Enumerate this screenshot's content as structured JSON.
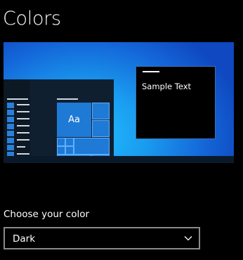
{
  "page": {
    "title": "Colors"
  },
  "preview": {
    "sample_text": "Sample Text",
    "tile_label": "Aa",
    "accent_color": "#1f7ad6",
    "background_color": "#1a9cf0"
  },
  "color_mode": {
    "label": "Choose your color",
    "selected": "Dark",
    "icon": "chevron-down-icon"
  }
}
